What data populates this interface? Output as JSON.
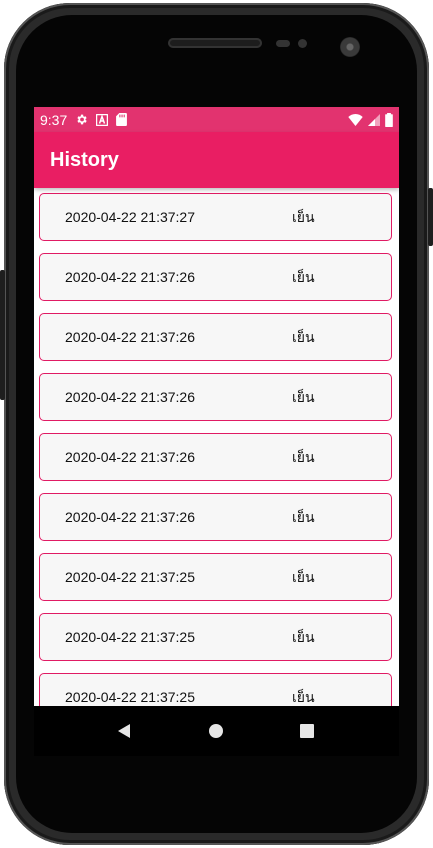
{
  "status_bar": {
    "time": "9:37",
    "icons_left": [
      "gear-icon",
      "a-icon",
      "sd-card-icon"
    ],
    "icons_right": [
      "wifi-icon",
      "signal-icon",
      "battery-icon"
    ],
    "color": "#e2336f"
  },
  "app_bar": {
    "title": "History",
    "color": "#e91e63"
  },
  "history": {
    "items": [
      {
        "datetime": "2020-04-22 21:37:27",
        "label": "เย็น"
      },
      {
        "datetime": "2020-04-22 21:37:26",
        "label": "เย็น"
      },
      {
        "datetime": "2020-04-22 21:37:26",
        "label": "เย็น"
      },
      {
        "datetime": "2020-04-22 21:37:26",
        "label": "เย็น"
      },
      {
        "datetime": "2020-04-22 21:37:26",
        "label": "เย็น"
      },
      {
        "datetime": "2020-04-22 21:37:26",
        "label": "เย็น"
      },
      {
        "datetime": "2020-04-22 21:37:25",
        "label": "เย็น"
      },
      {
        "datetime": "2020-04-22 21:37:25",
        "label": "เย็น"
      },
      {
        "datetime": "2020-04-22 21:37:25",
        "label": "เย็น"
      }
    ],
    "border_color": "#e01b64"
  },
  "nav_bar": {
    "buttons": [
      "back-icon",
      "home-icon",
      "recents-icon"
    ]
  }
}
